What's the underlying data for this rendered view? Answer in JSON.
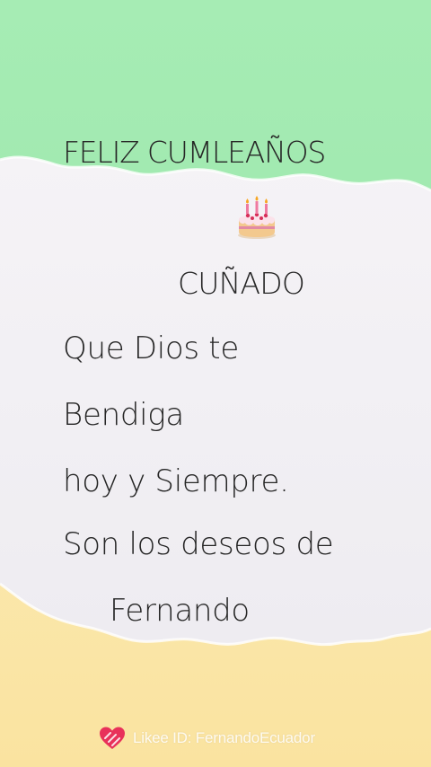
{
  "colors": {
    "top_green": "#9ee9ad",
    "paper": "#f1eff3",
    "bottom_yellow": "#fbe7a6",
    "text": "#262626",
    "heart": "#e8315a"
  },
  "card": {
    "title": "FELIZ CUMLEAÑOS",
    "emoji_icon": "birthday-cake-icon",
    "subtitle": "CUÑADO",
    "lines": [
      "Que Dios te",
      "Bendiga",
      "hoy y Siempre.",
      "Son los deseos de",
      "Fernando"
    ]
  },
  "watermark": {
    "icon": "likee-heart-icon",
    "text": "Likee ID: FernandoEcuador"
  }
}
